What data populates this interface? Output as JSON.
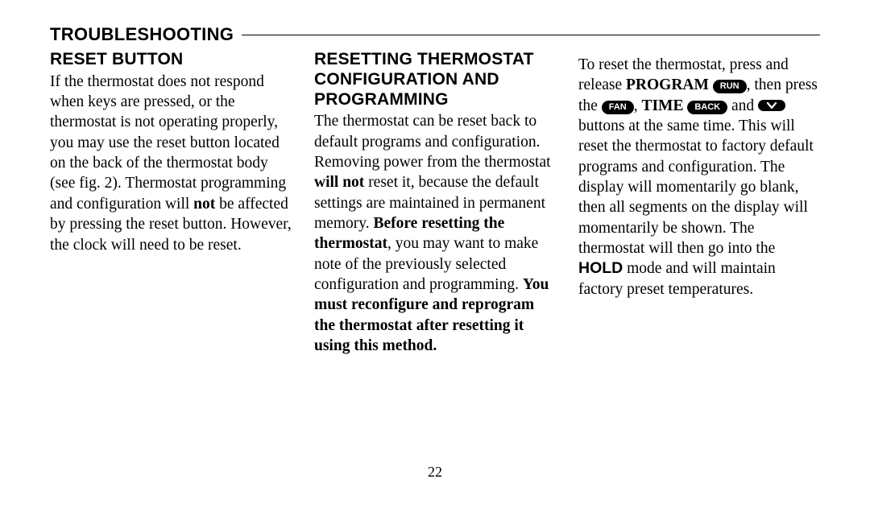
{
  "section_title": "TROUBLESHOOTING",
  "page_number": "22",
  "col1": {
    "heading": "RESET BUTTON",
    "p1a": "If the thermostat does not respond when keys are pressed, or the thermostat is not operating properly, you may use the reset button located on the back of the thermostat body (see fig. 2). Thermostat program­ming and configuration will ",
    "not": "not",
    "p1b": " be affected by pressing the reset button. However, the clock will need to be reset."
  },
  "col2": {
    "heading": "RESETTING THERMOSTAT CONFIGURATION AND PROGRAMMING",
    "p1a": "The thermostat can be reset back to default programs and configuration. Removing power from the thermo­stat ",
    "willnot": "will not",
    "p1b": " reset it, because the default settings are maintained in permanent memory. ",
    "before": "Before resetting the thermostat",
    "p1c": ", you may want to make note of the previously selected configuration and program­ming. ",
    "must": "You must reconfigure and reprogram the thermostat after resetting it using this method."
  },
  "col3": {
    "t1": "To reset the thermostat, press and release ",
    "program": "PROGRAM",
    "run": "RUN",
    "t2": ", then press the ",
    "fan": "FAN",
    "t3": ", ",
    "time": "TIME",
    "back": "BACK",
    "t4": " and ",
    "t5": " buttons at the same time. This will reset the thermostat to factory default programs and configuration. The display will momentarily go blank, then all segments on the display will momentarily be shown. The thermostat will then go into the ",
    "hold": "HOLD",
    "t6": " mode and will maintain factory preset temperatures."
  }
}
